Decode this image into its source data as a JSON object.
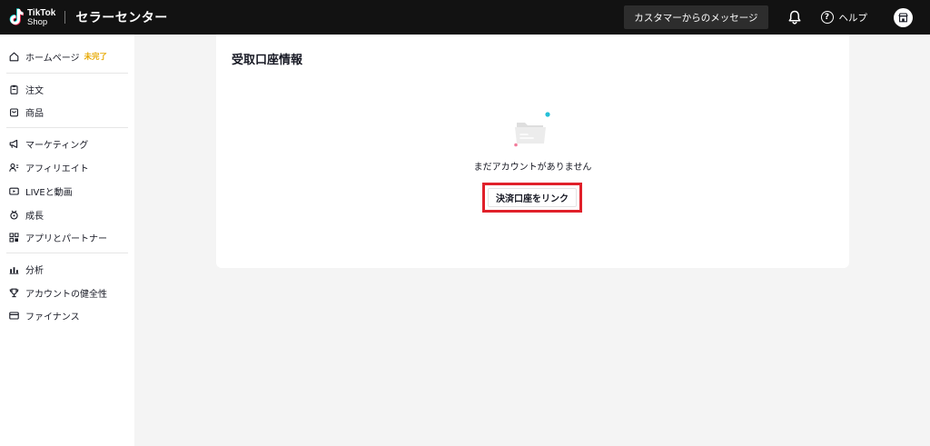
{
  "header": {
    "logo_line1": "TikTok",
    "logo_line2": "Shop",
    "app_title": "セラーセンター",
    "message_button": "カスタマーからのメッセージ",
    "help_label": "ヘルプ",
    "help_symbol": "?",
    "icons": [
      "tiktok-logo-icon",
      "bell-icon",
      "help-icon",
      "store-icon"
    ]
  },
  "sidebar": {
    "items": [
      {
        "label": "ホームページ",
        "badge": "未完了",
        "icon": "home-icon"
      },
      {
        "label": "注文",
        "icon": "clipboard-icon"
      },
      {
        "label": "商品",
        "icon": "bag-icon"
      },
      {
        "label": "マーケティング",
        "icon": "megaphone-icon"
      },
      {
        "label": "アフィリエイト",
        "icon": "users-icon"
      },
      {
        "label": "LIVEと動画",
        "icon": "video-icon"
      },
      {
        "label": "成長",
        "icon": "growth-icon"
      },
      {
        "label": "アプリとパートナー",
        "icon": "apps-icon"
      },
      {
        "label": "分析",
        "icon": "chart-icon"
      },
      {
        "label": "アカウントの健全性",
        "icon": "trophy-icon"
      },
      {
        "label": "ファイナンス",
        "icon": "card-icon"
      }
    ]
  },
  "main": {
    "title": "受取口座情報",
    "empty_message": "まだアカウントがありません",
    "link_button": "決済口座をリンク"
  },
  "colors": {
    "topbar": "#121212",
    "badge": "#e7a800",
    "highlight": "#e0202a",
    "accent_cyan": "#25c0d8",
    "accent_pink": "#f27c9b"
  }
}
